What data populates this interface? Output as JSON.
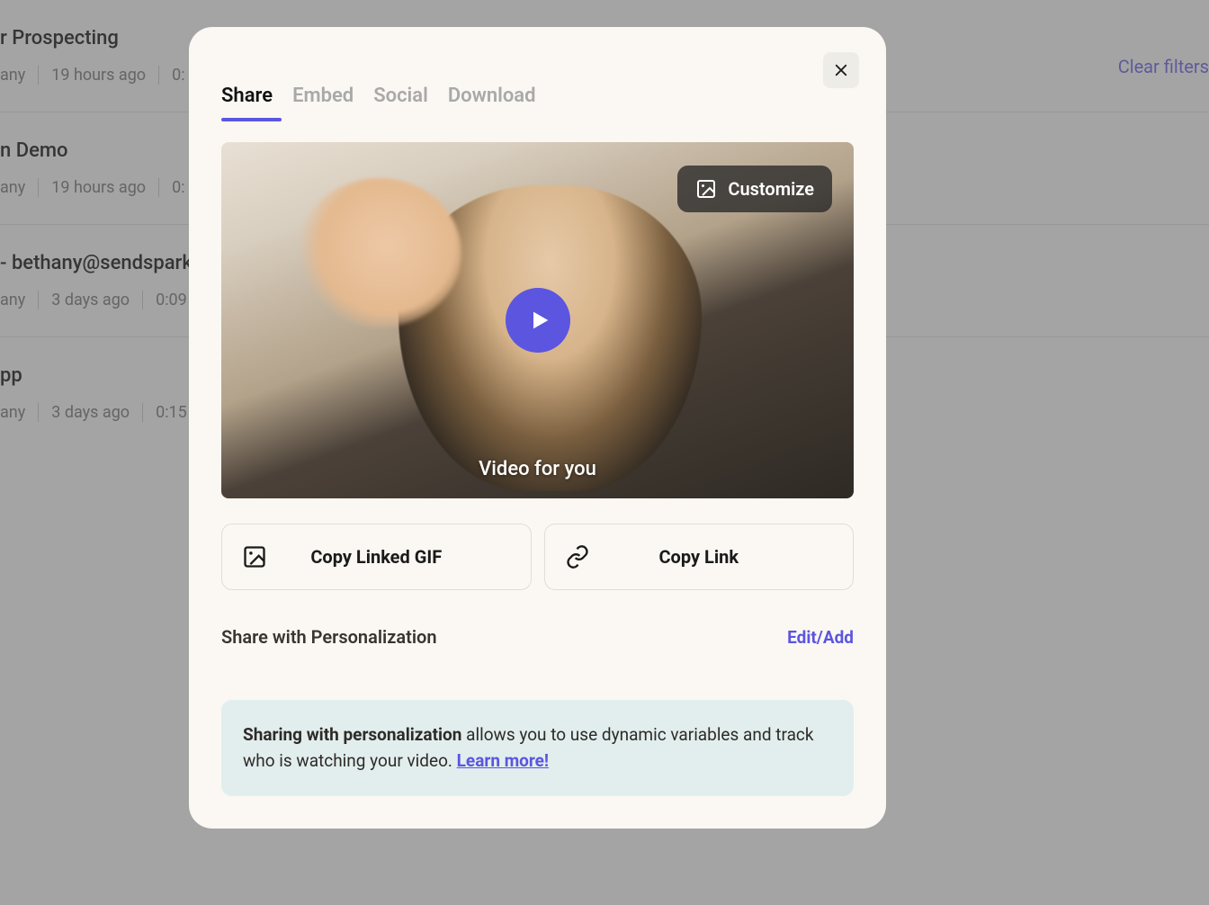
{
  "background": {
    "clear_filters": "Clear filters",
    "rows": [
      {
        "title": "r Prospecting",
        "meta": [
          "any",
          "19 hours ago",
          "0:"
        ]
      },
      {
        "title": "n Demo",
        "meta": [
          "any",
          "19 hours ago",
          "0:"
        ]
      },
      {
        "title": "- bethany@sendspark",
        "meta": [
          "any",
          "3 days ago",
          "0:09"
        ]
      },
      {
        "title": "pp",
        "meta": [
          "any",
          "3 days ago",
          "0:15"
        ]
      }
    ]
  },
  "modal": {
    "tabs": [
      {
        "label": "Share",
        "active": true
      },
      {
        "label": "Embed",
        "active": false
      },
      {
        "label": "Social",
        "active": false
      },
      {
        "label": "Download",
        "active": false
      }
    ],
    "customize_label": "Customize",
    "video_caption": "Video for you",
    "copy_gif_label": "Copy Linked GIF",
    "copy_link_label": "Copy Link",
    "section_title": "Share with Personalization",
    "edit_link": "Edit/Add",
    "info": {
      "bold": "Sharing with personalization",
      "rest": " allows you to use dynamic variables and track who is watching your video. ",
      "learn_more": "Learn more!"
    }
  }
}
